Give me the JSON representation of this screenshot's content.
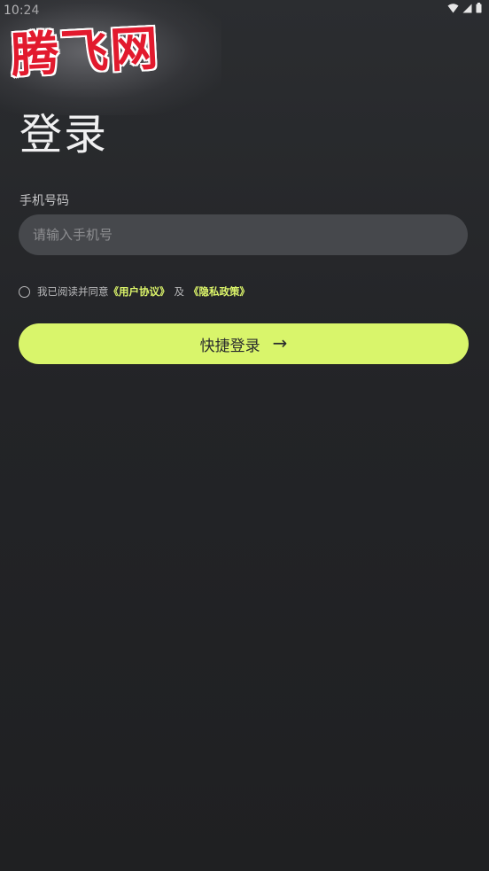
{
  "status_bar": {
    "time": "10:24",
    "icons": [
      "wifi-icon",
      "signal-icon",
      "battery-icon"
    ]
  },
  "watermark": {
    "text": "腾飞网"
  },
  "login": {
    "title": "登录",
    "phone_label": "手机号码",
    "phone_placeholder": "请输入手机号",
    "phone_value": "",
    "agreement_prefix": "我已阅读并同意",
    "user_agreement": "《用户协议》",
    "agreement_joiner": "及",
    "privacy_policy": "《隐私政策》",
    "agreement_checked": false,
    "submit_label": "快捷登录",
    "submit_arrow": "→"
  },
  "colors": {
    "accent": "#d9f56b",
    "link": "#dcf56a",
    "background": "#26272a",
    "input_bg": "#46484c"
  }
}
